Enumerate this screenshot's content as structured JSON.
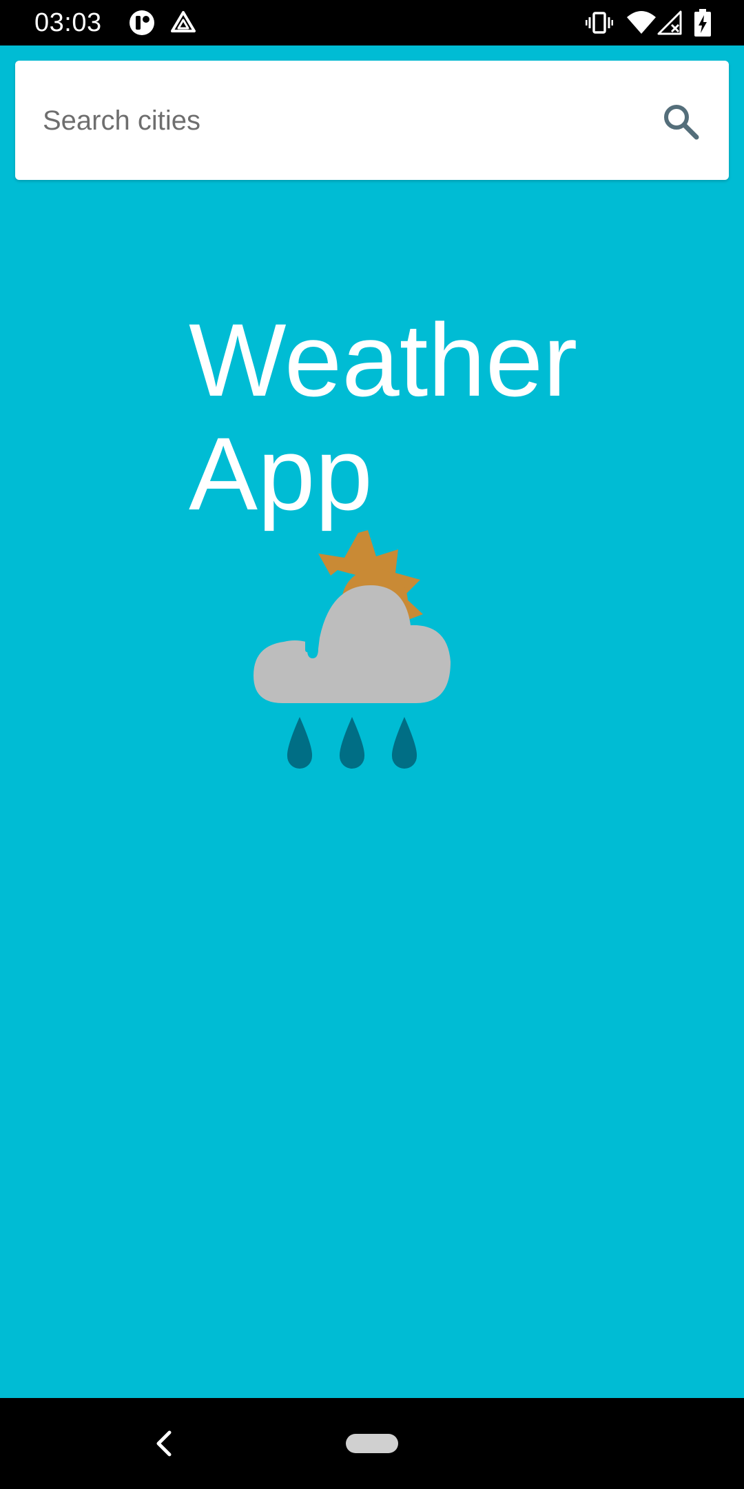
{
  "status_bar": {
    "time": "03:03",
    "left_icons": [
      "app-notification-icon",
      "drive-icon"
    ],
    "right_icons": [
      "vibrate-icon",
      "wifi-icon",
      "cellular-no-signal-icon",
      "battery-charging-icon"
    ]
  },
  "search": {
    "placeholder": "Search cities",
    "value": "",
    "icon": "search-icon"
  },
  "main": {
    "title": "Weather App",
    "illustration": "weather-rain-sun-icon"
  },
  "nav_bar": {
    "buttons": [
      "back-icon",
      "home-pill"
    ]
  },
  "colors": {
    "background": "#00bcd4",
    "status_bar": "#000000",
    "nav_bar": "#000000",
    "card": "#ffffff",
    "title_text": "#ffffff",
    "cloud": "#bdbdbd",
    "sun": "#c98a35",
    "raindrops": "#006e85",
    "search_icon": "#546e7a"
  }
}
